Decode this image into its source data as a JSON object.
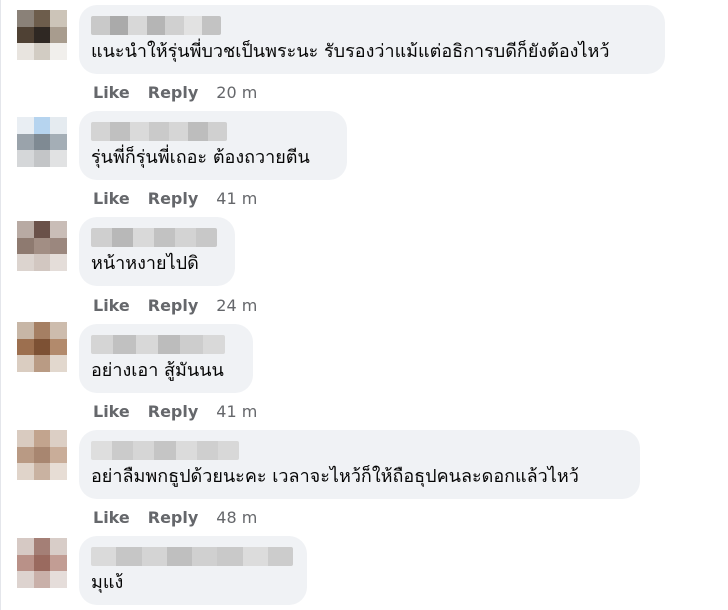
{
  "comments": [
    {
      "text": "แนะนำให้รุ่นพี่บวชเป็นพระนะ รับรองว่าแม้แต่อธิการบดีก็ยังต้องไหว้",
      "like_label": "Like",
      "reply_label": "Reply",
      "time": "20 m"
    },
    {
      "text": "รุ่นพี่ก็รุ่นพี่เถอะ ต้องถวายตีน",
      "like_label": "Like",
      "reply_label": "Reply",
      "time": "41 m"
    },
    {
      "text": "หน้าหงายไปดิ",
      "like_label": "Like",
      "reply_label": "Reply",
      "time": "24 m"
    },
    {
      "text": "อย่างเอา สู้มันนน",
      "like_label": "Like",
      "reply_label": "Reply",
      "time": "41 m"
    },
    {
      "text": "อย่าลืมพกธูปด้วยนะคะ เวลาจะไหว้ก็ให้ถือธุปคนละดอกแล้วไหว้",
      "like_label": "Like",
      "reply_label": "Reply",
      "time": "48 m"
    },
    {
      "text": "มุแง้"
    }
  ],
  "colors": {
    "bubble": "#f0f2f5",
    "secondary_text": "#65676b",
    "primary_text": "#050505"
  }
}
